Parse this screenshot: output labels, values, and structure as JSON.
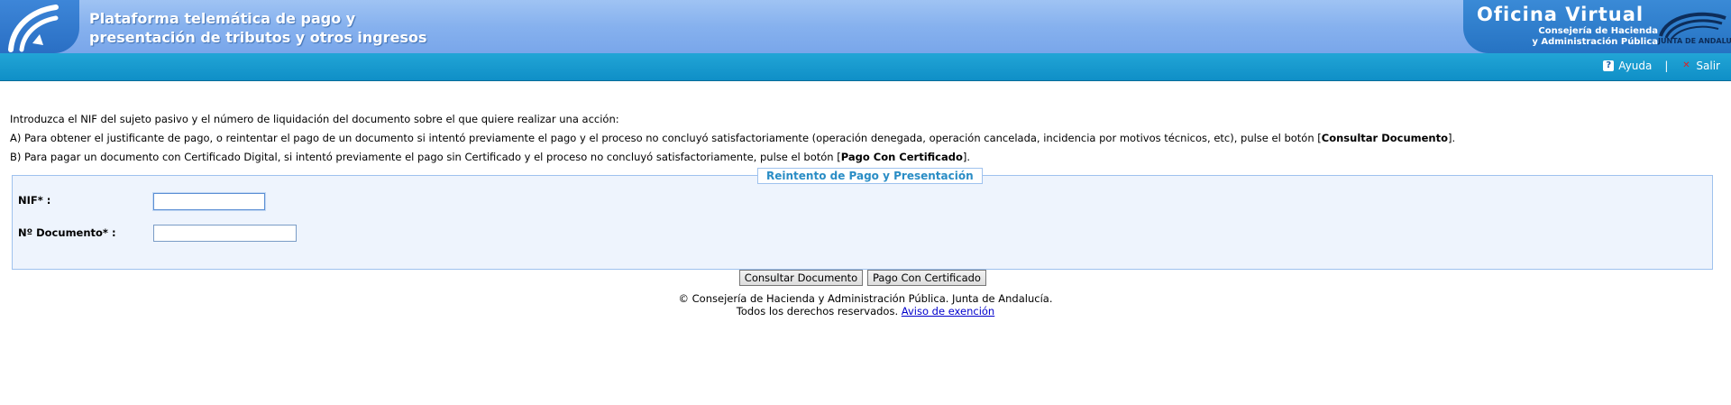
{
  "header": {
    "title_line1": "Plataforma telemática de pago y",
    "title_line2": "presentación de tributos y otros ingresos",
    "office_title": "Oficina Virtual",
    "office_sub1": "Consejería de Hacienda",
    "office_sub2": "y Administración Pública",
    "seal_text": "JUNTA DE ANDALUCIA",
    "logo_icon": "junta-andalucia-logo-icon"
  },
  "toolbar": {
    "help_label": "Ayuda",
    "separator": "|",
    "exit_label": "Salir"
  },
  "instructions": {
    "line1": "Introduzca el NIF del sujeto pasivo y el número de liquidación del documento sobre el que quiere realizar una acción:",
    "line2_prefix": "A) Para obtener el justificante de pago, o reintentar el pago de un documento si intentó previamente el pago y el proceso no concluyó satisfactoriamente (operación denegada, operación cancelada, incidencia por motivos técnicos, etc), pulse el botón [",
    "line2_bold": "Consultar Documento",
    "line2_suffix": "].",
    "line3_prefix": "B) Para pagar un documento con Certificado Digital, si intentó previamente el pago sin Certificado y el proceso no concluyó satisfactoriamente, pulse el botón [",
    "line3_bold": "Pago Con Certificado",
    "line3_suffix": "]."
  },
  "form": {
    "legend": "Reintento de Pago y Presentación",
    "nif_label": "NIF* :",
    "nif_value": "",
    "doc_label": "Nº Documento* :",
    "doc_value": ""
  },
  "buttons": {
    "consult": "Consultar Documento",
    "pay_cert": "Pago Con Certificado"
  },
  "footer": {
    "copyright": "© Consejería de Hacienda y Administración Pública. Junta de Andalucía.",
    "rights": "Todos los derechos reservados.",
    "link": "Aviso de exención"
  }
}
